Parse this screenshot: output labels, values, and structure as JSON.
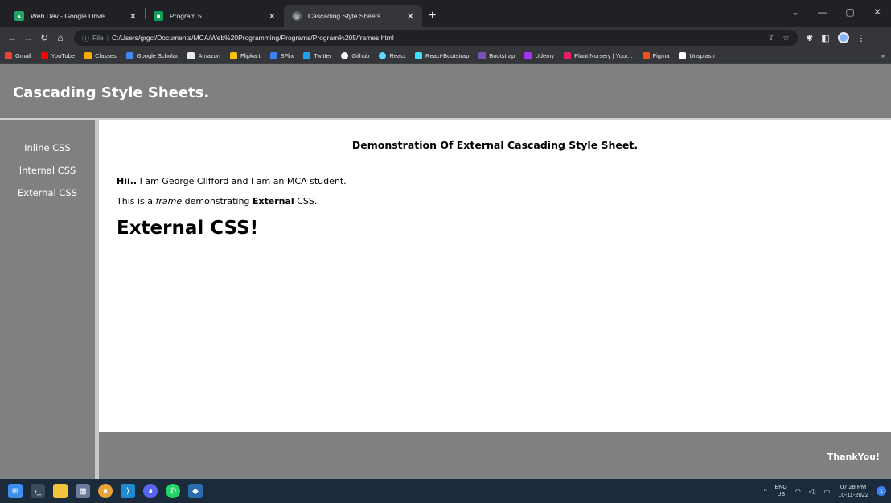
{
  "browser": {
    "tabs": [
      {
        "title": "Web Dev - Google Drive",
        "icon": "google-drive-icon",
        "active": false
      },
      {
        "title": "Program 5",
        "icon": "google-classroom-icon",
        "active": false
      },
      {
        "title": "Cascading Style Sheets",
        "icon": "globe-icon",
        "active": true
      }
    ],
    "new_tab": "+",
    "address": {
      "prefix": "File",
      "url": "C:/Users/grgcl/Documents/MCA/Web%20Programming/Programs/Program%205/frames.html"
    },
    "bookmarks": [
      {
        "label": "Gmail",
        "color": "#ea4335"
      },
      {
        "label": "YouTube",
        "color": "#ff0000"
      },
      {
        "label": "Classes",
        "color": "#f9ab00"
      },
      {
        "label": "Google Scholar",
        "color": "#4285f4"
      },
      {
        "label": "Amazon",
        "color": "#232f3e"
      },
      {
        "label": "Flipkart",
        "color": "#f7c600"
      },
      {
        "label": "SFlix",
        "color": "#3b82f6"
      },
      {
        "label": "Twitter",
        "color": "#1da1f2"
      },
      {
        "label": "Github",
        "color": "#ffffff"
      },
      {
        "label": "React",
        "color": "#61dafb"
      },
      {
        "label": "React-Bootstrap",
        "color": "#41e0fd"
      },
      {
        "label": "Bootstrap",
        "color": "#7952b3"
      },
      {
        "label": "Udemy",
        "color": "#a435f0"
      },
      {
        "label": "Plant Nursery | Your...",
        "color": "#e91e63"
      },
      {
        "label": "Figma",
        "color": "#f24e1e"
      },
      {
        "label": "Unsplash",
        "color": "#ffffff"
      }
    ],
    "bookmarks_more": "»"
  },
  "page": {
    "header_title": "Cascading Style Sheets.",
    "nav": [
      "Inline CSS",
      "Internal CSS",
      "External CSS"
    ],
    "main": {
      "heading": "Demonstration Of External Cascading Style Sheet.",
      "line1_bold": "Hii..",
      "line1_rest": " I am George Clifford and I am an MCA student.",
      "line2_a": "This is a ",
      "line2_em": "frame",
      "line2_b": " demonstrating ",
      "line2_strong": "External",
      "line2_c": " CSS.",
      "big": "External CSS!"
    },
    "footer": "ThankYou!"
  },
  "taskbar": {
    "lang_top": "ENG",
    "lang_bottom": "US",
    "time": "07:28 PM",
    "date": "10-11-2022",
    "notification_count": "1"
  }
}
